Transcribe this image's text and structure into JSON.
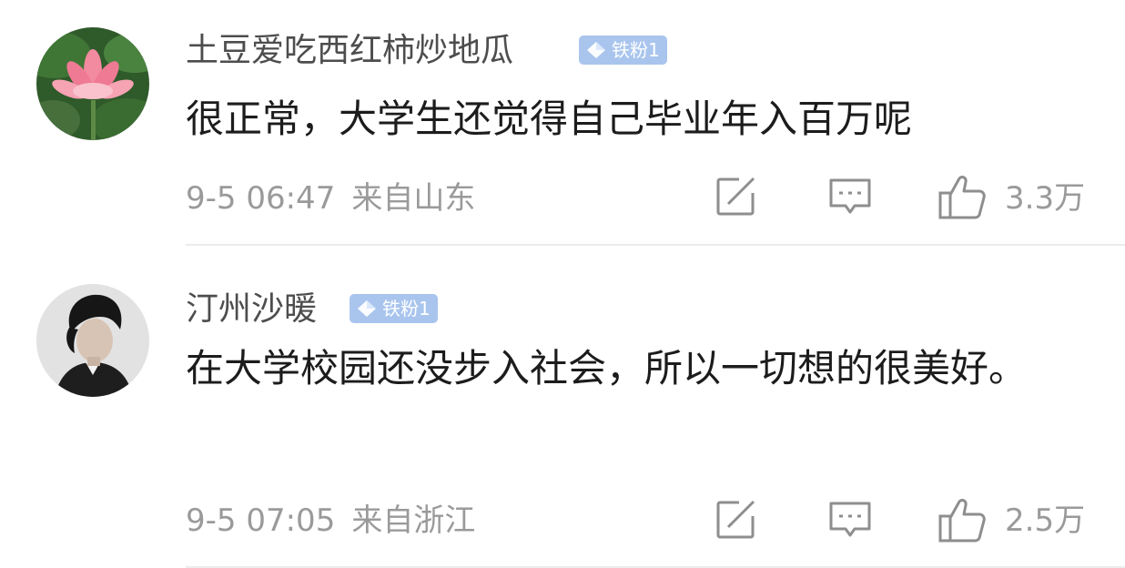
{
  "comments": [
    {
      "username": "土豆爱吃西红柿炒地瓜",
      "badge": "铁粉1",
      "content": "很正常，大学生还觉得自己毕业年入百万呢",
      "time": "9-5 06:47",
      "location": "来自山东",
      "likes": "3.3万",
      "avatar_icon": "lotus-avatar",
      "icons": [
        "repost-icon",
        "comment-icon",
        "like-icon"
      ]
    },
    {
      "username": "汀州沙暖",
      "badge": "铁粉1",
      "content": "在大学校园还没步入社会，所以一切想的很美好。",
      "time": "9-5 07:05",
      "location": "来自浙江",
      "likes": "2.5万",
      "avatar_icon": "portrait-avatar",
      "icons": [
        "repost-icon",
        "comment-icon",
        "like-icon"
      ]
    }
  ],
  "colors": {
    "badge_bg": "#a9c5ee",
    "username": "#4d4d4d",
    "meta": "#9a9a9a",
    "divider": "#ececec"
  }
}
